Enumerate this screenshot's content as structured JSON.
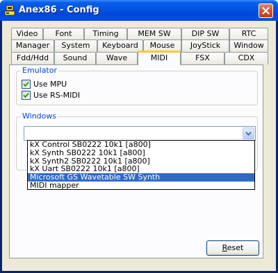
{
  "window": {
    "title": "Anex86 - Config"
  },
  "tabs": {
    "row1": [
      "Video",
      "Font",
      "Timing",
      "MEM SW",
      "DIP SW",
      "RTC"
    ],
    "row2": [
      "Manager",
      "System",
      "Keyboard",
      "Mouse",
      "JoyStick",
      "Window"
    ],
    "row3": [
      "Fdd/Hdd",
      "Sound",
      "Wave",
      "MIDI",
      "FSX",
      "CDX"
    ],
    "active": "MIDI"
  },
  "emulator": {
    "label": "Emulator",
    "use_mpu": {
      "label": "Use MPU",
      "checked": true
    },
    "use_rs_midi": {
      "label": "Use RS-MIDI",
      "checked": true
    }
  },
  "windows_group": {
    "label": "Windows",
    "combo_value": "",
    "options": [
      "kX Control SB0222 10k1 [a800]",
      "kX Synth SB0222 10k1 [a800]",
      "kX Synth2 SB0222 10k1 [a800]",
      "kX Uart SB0222 10k1 [a800]",
      "Microsoft GS Wavetable SW Synth",
      "MIDI mapper"
    ],
    "selected_option": "Microsoft GS Wavetable SW Synth"
  },
  "reset_button": {
    "label_underlined": "R",
    "label_rest": "eset"
  },
  "colors": {
    "titlebar": "#0055e5",
    "tab_highlight": "#ffc83c",
    "group_label": "#0046d5",
    "selection": "#316ac5",
    "check": "#21a121"
  }
}
